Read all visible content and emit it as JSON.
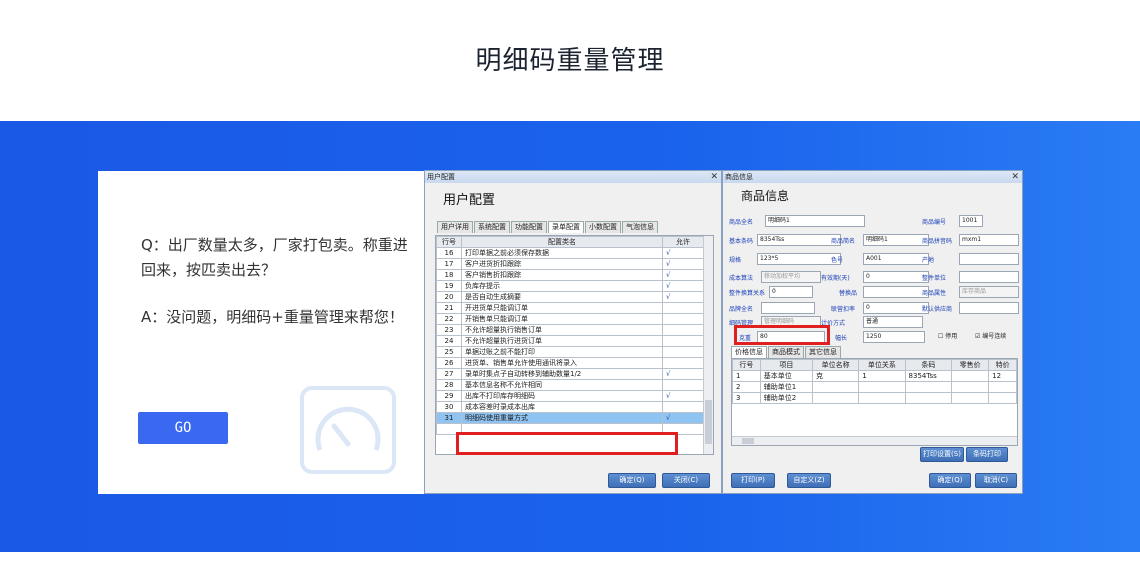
{
  "page": {
    "title": "明细码重量管理",
    "question": "Q：出厂数量太多，厂家打包卖。称重进回来，按匹卖出去？",
    "answer": "A：没问题，明细码+重量管理来帮您！",
    "go_label": "GO",
    "accent": "#1a58e6",
    "button_color": "#3a68f0"
  },
  "user_config": {
    "window_title": "用户配置",
    "heading": "用户配置",
    "tabs": [
      "用户详用",
      "系统配置",
      "功能配置",
      "录单配置",
      "小数配置",
      "气泡信息"
    ],
    "active_tab": "录单配置",
    "columns": [
      "行号",
      "配置类名",
      "允许"
    ],
    "rows": [
      {
        "no": "16",
        "name": "打印单据之前必须保存数据",
        "allow": "√"
      },
      {
        "no": "17",
        "name": "客户进货折扣跟踪",
        "allow": "√"
      },
      {
        "no": "18",
        "name": "客户销售折扣跟踪",
        "allow": "√"
      },
      {
        "no": "19",
        "name": "负库存提示",
        "allow": "√"
      },
      {
        "no": "20",
        "name": "是否自动生成摘要",
        "allow": "√"
      },
      {
        "no": "21",
        "name": "开进货单只能调订单",
        "allow": ""
      },
      {
        "no": "22",
        "name": "开销售单只能调订单",
        "allow": ""
      },
      {
        "no": "23",
        "name": "不允许超量执行销售订单",
        "allow": ""
      },
      {
        "no": "24",
        "name": "不允许超量执行进货订单",
        "allow": ""
      },
      {
        "no": "25",
        "name": "单据过账之前不能打印",
        "allow": ""
      },
      {
        "no": "26",
        "name": "进货单、销售单允许使用通讯将录入",
        "allow": ""
      },
      {
        "no": "27",
        "name": "录单时集点子自动转移到辅助数量1/2",
        "allow": "√"
      },
      {
        "no": "28",
        "name": "基本信息名称不允许相同",
        "allow": ""
      },
      {
        "no": "29",
        "name": "出库不打印库存明细码",
        "allow": "√"
      },
      {
        "no": "30",
        "name": "成本容差时录成本出库",
        "allow": ""
      },
      {
        "no": "31",
        "name": "明细码使用重量方式",
        "allow": "√"
      }
    ],
    "ok_label": "确定(Q)",
    "close_label": "关闭(C)"
  },
  "product_info": {
    "window_title": "商品信息",
    "heading": "商品信息",
    "fields": [
      {
        "label": "商品全名",
        "value": "明细码1"
      },
      {
        "label": "商品编号",
        "value": "1001"
      },
      {
        "label": "基本条码",
        "value": "8354Tss"
      },
      {
        "label": "商品简名",
        "value": "明细码1"
      },
      {
        "label": "商品拼音码",
        "value": "mxm1"
      },
      {
        "label": "规格",
        "value": "123*5"
      },
      {
        "label": "色号",
        "value": "A001"
      },
      {
        "label": "产地",
        "value": ""
      },
      {
        "label": "成本算法",
        "value": "移动加权平均"
      },
      {
        "label": "有效期(天)",
        "value": "0"
      },
      {
        "label": "整件单位",
        "value": ""
      },
      {
        "label": "整件换算关系",
        "value": "0"
      },
      {
        "label": "替换品",
        "value": ""
      },
      {
        "label": "商品属性",
        "value": "库存商品"
      },
      {
        "label": "品牌全名",
        "value": ""
      },
      {
        "label": "联营扣率",
        "value": "0"
      },
      {
        "label": "默认供应商",
        "value": ""
      },
      {
        "label": "细码管理",
        "value": "管理明细码"
      },
      {
        "label": "计价方式",
        "value": "普通"
      },
      {
        "label": "克重",
        "value": "80"
      },
      {
        "label": "幅长",
        "value": "1250"
      }
    ],
    "check_disable": "停用",
    "check_serial": "编号连续",
    "tabs": [
      "价格信息",
      "商品模式",
      "其它信息"
    ],
    "columns": [
      "行号",
      "项目",
      "单位名称",
      "单位关系",
      "条码",
      "零售价",
      "特价"
    ],
    "rows": [
      {
        "no": "1",
        "item": "基本单位",
        "unit": "克",
        "rel": "1",
        "code": "8354Tss",
        "retail": "",
        "special": "12"
      },
      {
        "no": "2",
        "item": "辅助单位1",
        "unit": "",
        "rel": "",
        "code": "",
        "retail": "",
        "special": ""
      },
      {
        "no": "3",
        "item": "辅助单位2",
        "unit": "",
        "rel": "",
        "code": "",
        "retail": "",
        "special": ""
      }
    ],
    "print_setup_label": "打印设置(S)",
    "barcode_print_label": "条码打印",
    "print_label": "打印(P)",
    "custom_label": "自定义(Z)",
    "ok_label": "确定(Q)",
    "cancel_label": "取消(C)"
  }
}
